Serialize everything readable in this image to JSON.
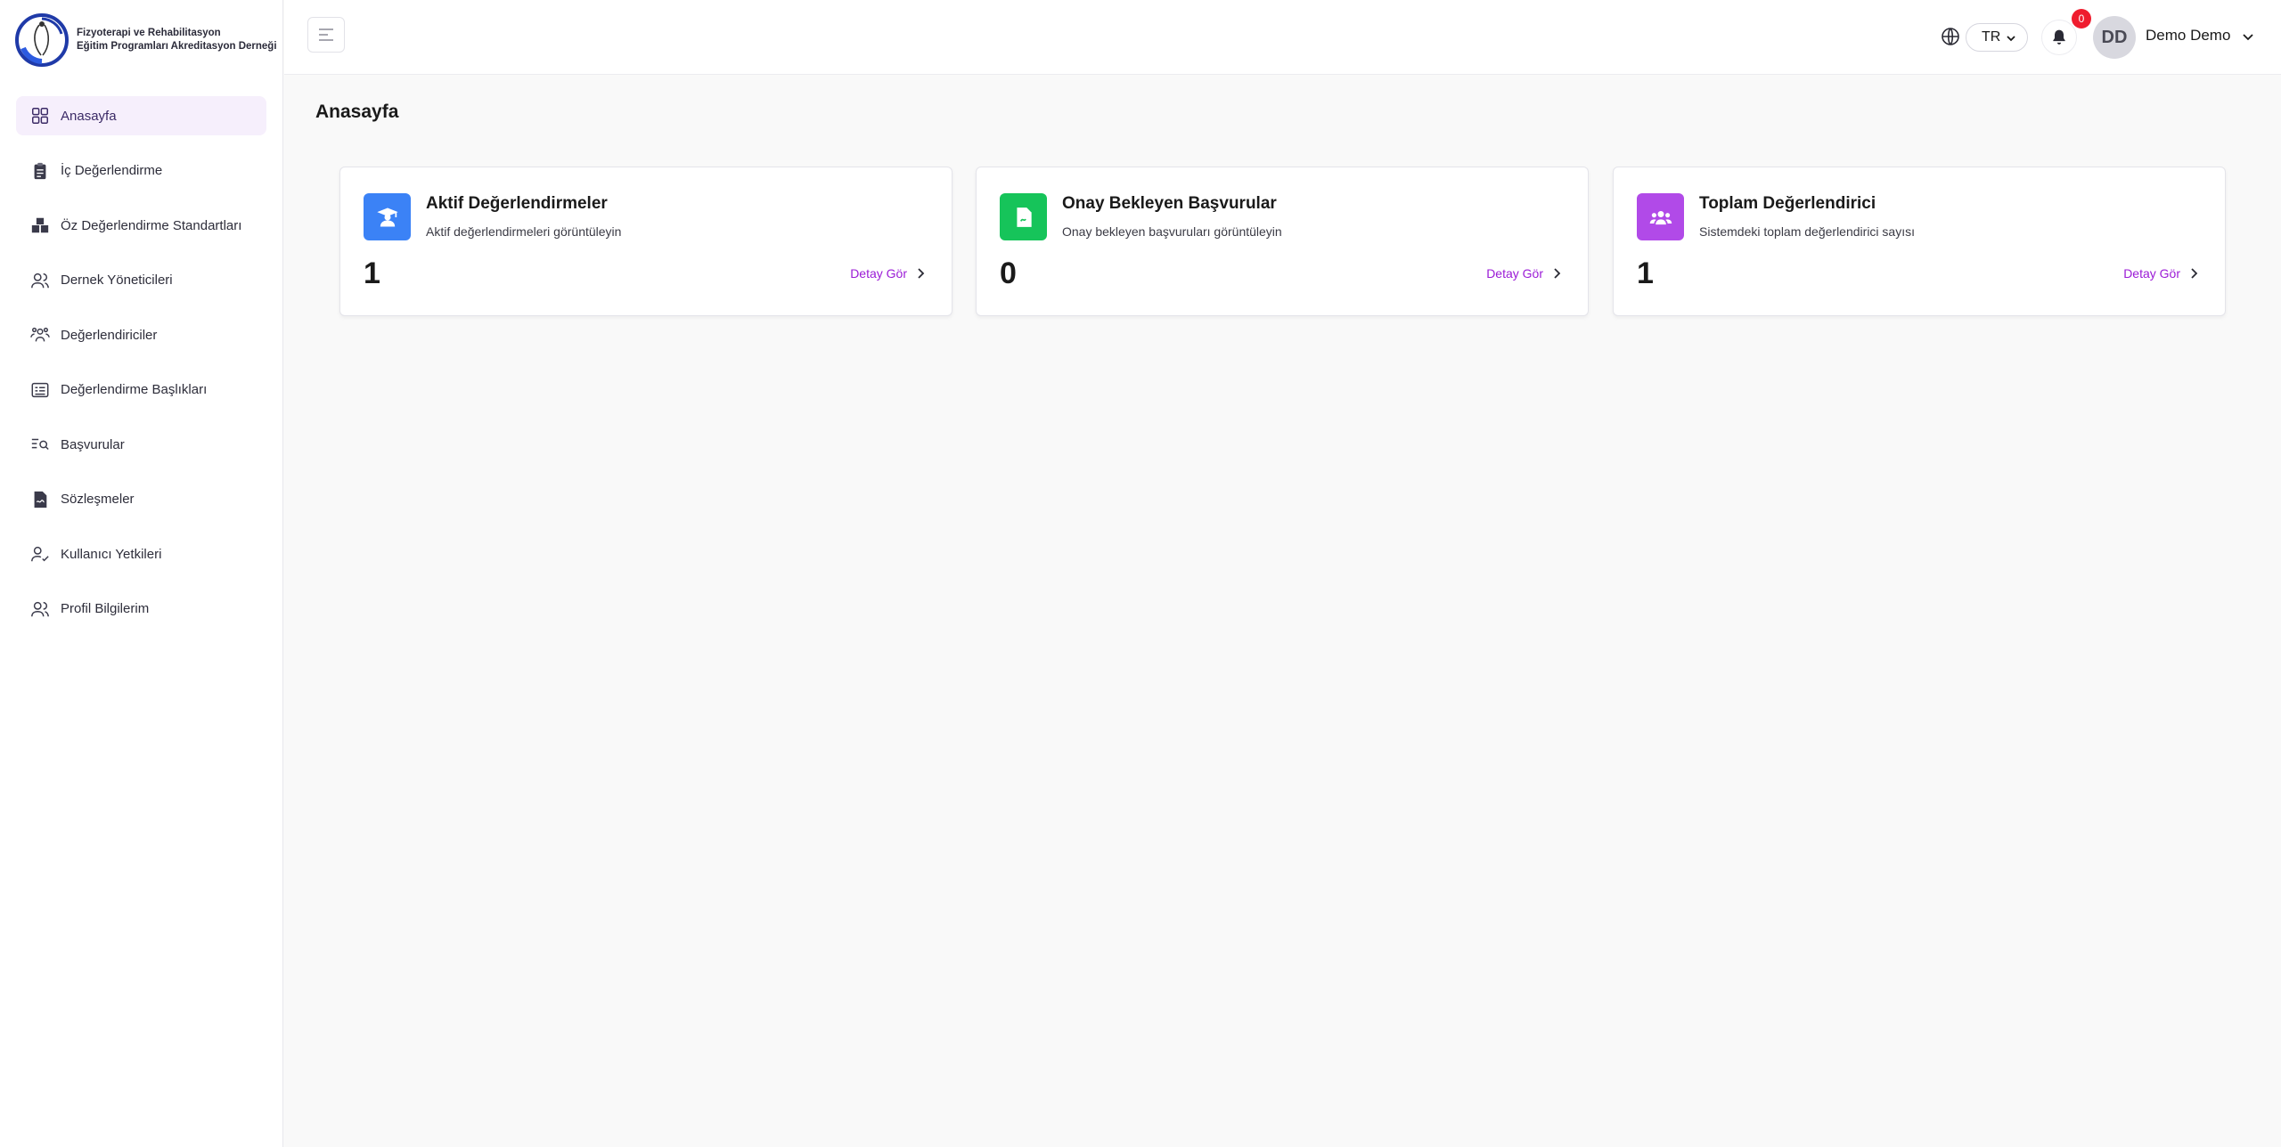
{
  "brand": {
    "line1": "Fizyoterapi ve Rehabilitasyon",
    "line2": "Eğitim Programları Akreditasyon Derneği"
  },
  "sidebar": {
    "items": [
      {
        "label": "Anasayfa",
        "icon": "dashboard-grid-icon",
        "active": true
      },
      {
        "label": "İç Değerlendirme",
        "icon": "clipboard-icon"
      },
      {
        "label": "Öz Değerlendirme Standartları",
        "icon": "blocks-icon"
      },
      {
        "label": "Dernek Yöneticileri",
        "icon": "users-icon"
      },
      {
        "label": "Değerlendiriciler",
        "icon": "group-icon"
      },
      {
        "label": "Değerlendirme Başlıkları",
        "icon": "list-card-icon"
      },
      {
        "label": "Başvurular",
        "icon": "search-list-icon"
      },
      {
        "label": "Sözleşmeler",
        "icon": "contract-icon"
      },
      {
        "label": "Kullanıcı Yetkileri",
        "icon": "user-check-icon"
      },
      {
        "label": "Profil Bilgilerim",
        "icon": "profile-icon"
      }
    ]
  },
  "header": {
    "language": "TR",
    "notification_count": "0",
    "avatar_initials": "DD",
    "user_name": "Demo Demo"
  },
  "page": {
    "title": "Anasayfa"
  },
  "cards": [
    {
      "title": "Aktif Değerlendirmeler",
      "subtitle": "Aktif değerlendirmeleri görüntüleyin",
      "value": "1",
      "link": "Detay Gör",
      "color": "#3b82f6",
      "icon": "graduate-icon"
    },
    {
      "title": "Onay Bekleyen Başvurular",
      "subtitle": "Onay bekleyen başvuruları görüntüleyin",
      "value": "0",
      "link": "Detay Gör",
      "color": "#16c45a",
      "icon": "document-icon"
    },
    {
      "title": "Toplam Değerlendirici",
      "subtitle": "Sistemdeki toplam değerlendirici sayısı",
      "value": "1",
      "link": "Detay Gör",
      "color": "#b14ae8",
      "icon": "team-icon"
    }
  ],
  "colors": {
    "accent": "#9b1bd6",
    "active_bg": "#f6effc",
    "badge": "#ef1c2e"
  }
}
